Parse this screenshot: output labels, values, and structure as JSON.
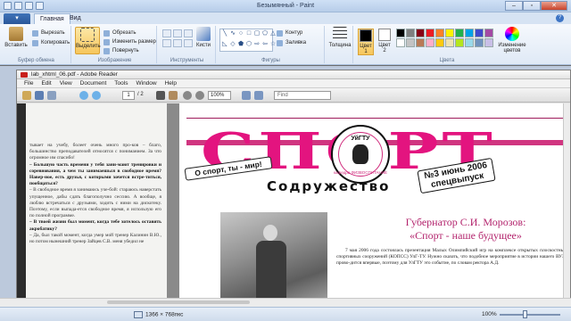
{
  "window": {
    "title": "Безымянный - Paint"
  },
  "ribbon_tabs": {
    "home": "Главная",
    "view": "Вид"
  },
  "clipboard": {
    "paste": "Вставить",
    "cut": "Вырезать",
    "copy": "Копировать",
    "label": "Буфер обмена"
  },
  "image": {
    "select": "Выделить",
    "crop": "Обрезать",
    "resize": "Изменить размер",
    "rotate": "Повернуть",
    "label": "Изображение"
  },
  "tools": {
    "label": "Инструменты",
    "brushes": "Кисти"
  },
  "shapes": {
    "label": "Фигуры",
    "outline": "Контур",
    "fill": "Заливка"
  },
  "size": {
    "label": "Толщина"
  },
  "colors": {
    "color1": "Цвет 1",
    "color2": "Цвет 2",
    "edit": "Изменение цветов",
    "label": "Цвета",
    "palette": [
      "#000000",
      "#7f7f7f",
      "#880015",
      "#ed1c24",
      "#ff7f27",
      "#fff200",
      "#22b14c",
      "#00a2e8",
      "#3f48cc",
      "#a349a4",
      "#ffffff",
      "#c3c3c3",
      "#b97a57",
      "#ffaec9",
      "#ffc90e",
      "#efe4b0",
      "#b5e61d",
      "#99d9ea",
      "#7092be",
      "#c8bfe7"
    ]
  },
  "reader": {
    "title": "lab_xhtml_06.pdf - Adobe Reader",
    "menu": [
      "File",
      "Edit",
      "View",
      "Document",
      "Tools",
      "Window",
      "Help"
    ],
    "page_current": "1",
    "page_total": "/ 2",
    "zoom": "100%",
    "find_placeholder": "Find"
  },
  "left_page": {
    "text1": "тывает на учебу, болеет очень много про-ков – благо, большинство преподавателей относятся с пониманием. За что огромное им спасибо!",
    "q1": "– Большую часть времени у тебя зани-мают тренировки и соревнования, а чем ты занимаешься в свободное время? Навер-ное, есть друзья, с которыми хочется встре-титься, пообщаться?",
    "text2": "– В свободное время я занимаюсь уче-бой: стараюсь наверстать упущенное, дабы сдать благополучно сессию. А вообще, я люблю встречаться с друзьями, ходить с ними на дискотеку. Поэтому, если выпада-ется свободное время, я использую его по полной программе.",
    "q2": "– В твоей жизни был момент, когда тебе хотелось оставить акробатику?",
    "text3": "– Да, был такой момент, когда умер мой тренер Калинин В.Ю., но потом нынешний тренер Зайцев С.В. меня убедил не"
  },
  "newspaper": {
    "masthead": "СПОРТ",
    "tagline": "О спорт, ты - мир!",
    "issue": "№3 июнь 2006",
    "special": "спецвыпуск",
    "logo_abbr": "УйГТУ",
    "logo_ring": "кафедра ФИЗВОСПИТАНИЕ",
    "subtitle": "Содружество",
    "headline1": "Губернатор С.И. Морозов:",
    "headline2": "«Спорт - наше будущее»",
    "article": "7 мая 2006 года состоялась презентация Малых Олимпийский игр на комплексе открытых плоскостных спортивных сооружений (КОПСС) УлГ-ТУ. Нужно сказать, что подобное мероприятие в истории нашего ВУЗа прово-дится впервые, поэтому для УлГТУ это событие, по словам ректора А.Д."
  },
  "status": {
    "dimensions": "1366 × 768пкс",
    "zoom": "100%"
  }
}
